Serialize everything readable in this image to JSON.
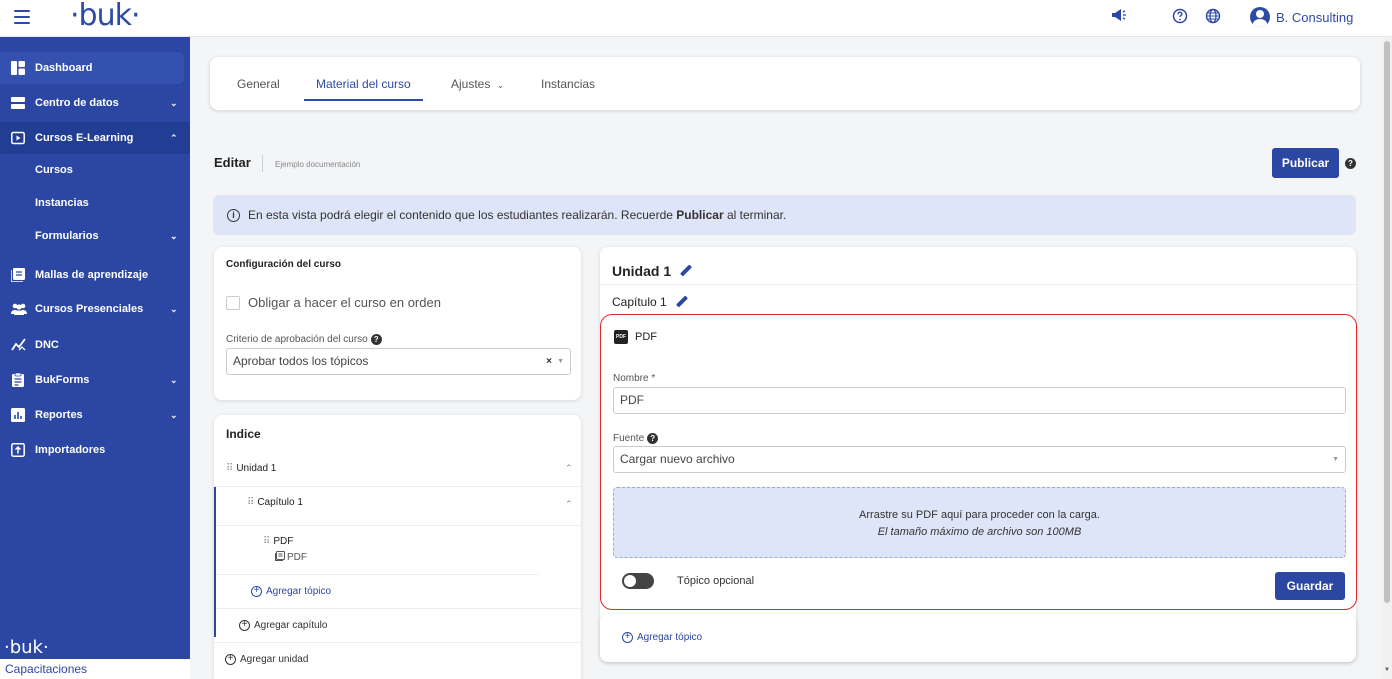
{
  "topbar": {
    "logo": "·buk·",
    "icons": [
      "megaphone-icon",
      "help-circle-icon",
      "globe-icon"
    ],
    "user_name": "B. Consulting"
  },
  "sidebar": {
    "items": [
      {
        "label": "Dashboard",
        "icon": "dashboard-icon"
      },
      {
        "label": "Centro de datos",
        "icon": "database-icon"
      },
      {
        "label": "Cursos E-Learning",
        "icon": "play-icon"
      },
      {
        "label": "Mallas de aprendizaje",
        "icon": "book-icon"
      },
      {
        "label": "Cursos Presenciales",
        "icon": "users-icon"
      },
      {
        "label": "DNC",
        "icon": "chart-line-icon"
      },
      {
        "label": "BukForms",
        "icon": "clipboard-icon"
      },
      {
        "label": "Reportes",
        "icon": "bar-chart-icon"
      },
      {
        "label": "Importadores",
        "icon": "upload-icon"
      }
    ],
    "sub_items": [
      "Cursos",
      "Instancias",
      "Formularios"
    ],
    "footer_logo": "·buk·",
    "footer_label": "Capacitaciones"
  },
  "tabs": {
    "general": "General",
    "material": "Material del curso",
    "ajustes": "Ajustes",
    "instancias": "Instancias"
  },
  "editar": {
    "title": "Editar",
    "subtitle": "Ejemplo documentación",
    "publish_label": "Publicar"
  },
  "info": {
    "text_before": "En esta vista podrá elegir el contenido que los estudiantes realizarán. Recuerde ",
    "text_bold": "Publicar",
    "text_after": " al terminar."
  },
  "config": {
    "title": "Configuración del curso",
    "checkbox_label": "Obligar a hacer el curso en orden",
    "criterio_label": "Criterio de aprobación del curso",
    "criterio_value": "Aprobar todos los tópicos"
  },
  "indice": {
    "title": "Indice",
    "unidad": "Unidad 1",
    "capitulo": "Capítulo 1",
    "topic_name": "PDF",
    "topic_type": "PDF",
    "add_topic": "Agregar tópico",
    "add_chapter": "Agregar capítulo",
    "add_unit": "Agregar unidad"
  },
  "editor": {
    "unidad_title": "Unidad 1",
    "capitulo_title": "Capítulo 1",
    "topic_header": "PDF",
    "nombre_label": "Nombre *",
    "nombre_value": "PDF",
    "fuente_label": "Fuente",
    "fuente_value": "Cargar nuevo archivo",
    "drop_line1": "Arrastre su PDF aquí para proceder con la carga.",
    "drop_line2": "El tamaño máximo de archivo son 100MB",
    "toggle_label": "Tópico opcional",
    "save_label": "Guardar",
    "add_topic": "Agregar tópico"
  },
  "colors": {
    "brand": "#2b47a3",
    "highlight_border": "#e02626"
  }
}
